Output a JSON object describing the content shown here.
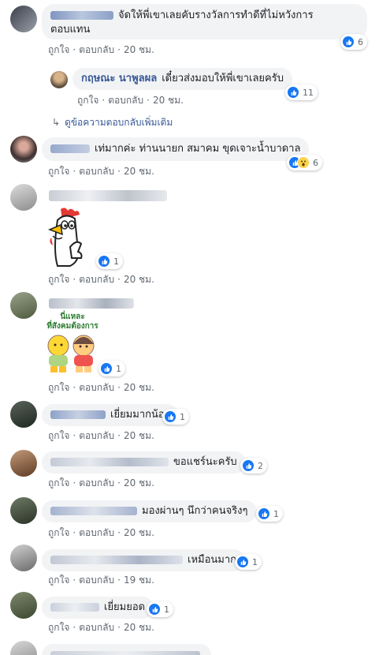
{
  "reaction_colors": {
    "like": "#1877f2",
    "wow": "#fcd34d"
  },
  "action_labels": {
    "like": "ถูกใจ",
    "reply": "ตอบกลับ"
  },
  "comments": [
    {
      "text1": "จัดให้พี่เขาเลยคับรางวัลการทำดีที่ไม่หวังการ",
      "text2": "ตอบแทน",
      "time": "20 ชม.",
      "reaction_count": "6"
    },
    {
      "name": "กฤษณะ นาพูลผล",
      "text": "เดี๋ยวส่งมอบให้พี่เขาเลยครับ",
      "time": "20 ชม.",
      "reaction_count": "11"
    },
    {
      "text": "เท่มากค่ะ ท่านนายก สมาคม ขุดเจาะน้ำบาดาล",
      "time": "20 ชม.",
      "reaction_count": "6"
    },
    {
      "time": "20 ชม.",
      "reaction_count": "1"
    },
    {
      "sticker_text1": "นี่แหละ",
      "sticker_text2": "ที่สังคมต้องการ",
      "time": "20 ชม.",
      "reaction_count": "1"
    },
    {
      "text": "เยี่ยมมากน้อง",
      "time": "20 ชม.",
      "reaction_count": "1"
    },
    {
      "text": "ขอแชร์นะครับ",
      "time": "20 ชม.",
      "reaction_count": "2"
    },
    {
      "text": "มองผ่านๆ นึกว่าคนจริงๆ",
      "time": "20 ชม.",
      "reaction_count": "1"
    },
    {
      "text": "เหมือนมาก",
      "time": "19 ชม.",
      "reaction_count": "1"
    },
    {
      "text": "เยี่ยมยอด",
      "time": "20 ชม.",
      "reaction_count": "1"
    }
  ],
  "view_more_replies": "ดูข้อความตอบกลับเพิ่มเติม"
}
